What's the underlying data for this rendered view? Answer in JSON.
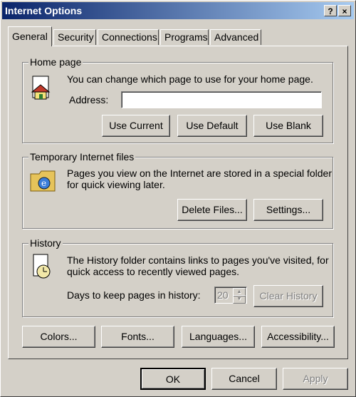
{
  "window": {
    "title": "Internet Options",
    "help_label": "?",
    "close_label": "×"
  },
  "tabs": [
    {
      "label": "General"
    },
    {
      "label": "Security"
    },
    {
      "label": "Connections"
    },
    {
      "label": "Programs"
    },
    {
      "label": "Advanced"
    }
  ],
  "home_page": {
    "group_label": "Home page",
    "description": "You can change which page to use for your home page.",
    "address_label": "Address:",
    "address_value": "",
    "use_current": "Use Current",
    "use_default": "Use Default",
    "use_blank": "Use Blank"
  },
  "temp_files": {
    "group_label": "Temporary Internet files",
    "description_1": "Pages you view on the Internet are stored in a special folder",
    "description_2": "for quick viewing later.",
    "delete_files": "Delete Files...",
    "settings": "Settings..."
  },
  "history": {
    "group_label": "History",
    "description_1": "The History folder contains links to pages you've visited, for",
    "description_2": "quick access to recently viewed pages.",
    "days_label": "Days to keep pages in history:",
    "days_value": "20",
    "clear_history": "Clear History"
  },
  "bottom_buttons": {
    "colors": "Colors...",
    "fonts": "Fonts...",
    "languages": "Languages...",
    "accessibility": "Accessibility..."
  },
  "dialog_buttons": {
    "ok": "OK",
    "cancel": "Cancel",
    "apply": "Apply"
  },
  "colors": {
    "titlebar_start": "#0a246a",
    "titlebar_end": "#a6caf0",
    "face": "#d4d0c8"
  }
}
